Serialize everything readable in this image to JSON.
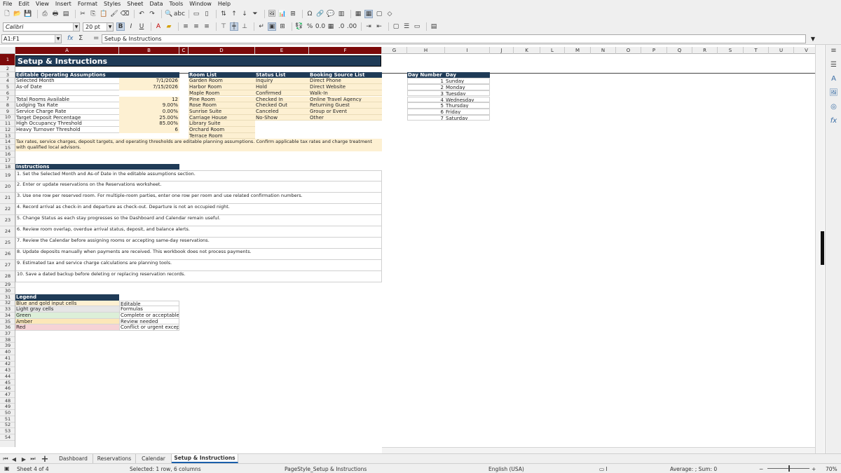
{
  "menu": [
    "File",
    "Edit",
    "View",
    "Insert",
    "Format",
    "Styles",
    "Sheet",
    "Data",
    "Tools",
    "Window",
    "Help"
  ],
  "font": {
    "name": "Calibri",
    "size": "20 pt"
  },
  "formula_bar": {
    "name_box": "A1:F1",
    "fx": "fx",
    "sum": "Σ",
    "equals": "=",
    "content": "Setup & Instructions"
  },
  "columns": [
    "A",
    "B",
    "C",
    "D",
    "E",
    "F",
    "G",
    "H",
    "I",
    "J",
    "K",
    "L",
    "M",
    "N",
    "O",
    "P",
    "Q",
    "R",
    "S",
    "T",
    "U",
    "V"
  ],
  "title": "Setup & Instructions",
  "assumptions": {
    "header": "Editable Operating Assumptions",
    "rows": [
      {
        "label": "Selected Month",
        "value": "7/1/2026"
      },
      {
        "label": "As-of Date",
        "value": "7/15/2026"
      },
      {
        "label": "",
        "value": ""
      },
      {
        "label": "Total Rooms Available",
        "value": "12"
      },
      {
        "label": "Lodging Tax Rate",
        "value": "9.00%"
      },
      {
        "label": "Service Charge Rate",
        "value": "0.00%"
      },
      {
        "label": "Target Deposit Percentage",
        "value": "25.00%"
      },
      {
        "label": "High Occupancy Threshold",
        "value": "85.00%"
      },
      {
        "label": "Heavy Turnover Threshold",
        "value": "6"
      }
    ]
  },
  "room_list": {
    "header": "Room List",
    "items": [
      "Garden Room",
      "Harbor Room",
      "Maple Room",
      "Pine Room",
      "Rose Room",
      "Sunrise Suite",
      "Carriage House",
      "Library Suite",
      "Orchard Room",
      "Terrace Room"
    ]
  },
  "status_list": {
    "header": "Status List",
    "items": [
      "Inquiry",
      "Hold",
      "Confirmed",
      "Checked In",
      "Checked Out",
      "Canceled",
      "No-Show"
    ]
  },
  "booking_list": {
    "header": "Booking Source List",
    "items": [
      "Direct Phone",
      "Direct Website",
      "Walk-In",
      "Online Travel Agency",
      "Returning Guest",
      "Group or Event",
      "Other"
    ]
  },
  "days": {
    "header_num": "Day Number",
    "header_day": "Day",
    "rows": [
      {
        "n": "1",
        "d": "Sunday"
      },
      {
        "n": "2",
        "d": "Monday"
      },
      {
        "n": "3",
        "d": "Tuesday"
      },
      {
        "n": "4",
        "d": "Wednesday"
      },
      {
        "n": "5",
        "d": "Thursday"
      },
      {
        "n": "6",
        "d": "Friday"
      },
      {
        "n": "7",
        "d": "Saturday"
      }
    ]
  },
  "note": "Tax rates, service charges, deposit targets, and operating thresholds are editable planning assumptions. Confirm applicable tax rates and charge treatment with qualified local advisors.",
  "instructions": {
    "header": "Instructions",
    "items": [
      "1. Set the Selected Month and As-of Date in the editable assumptions section.",
      "2. Enter or update reservations on the Reservations worksheet.",
      "3. Use one row per reserved room. For multiple-room parties, enter one row per room and use related confirmation numbers.",
      "4. Record arrival as check-in and departure as check-out. Departure is not an occupied night.",
      "5. Change Status as each stay progresses so the Dashboard and Calendar remain useful.",
      "6. Review room overlap, overdue arrival status, deposit, and balance alerts.",
      "7. Review the Calendar before assigning rooms or accepting same-day reservations.",
      "8. Update deposits manually when payments are received. This workbook does not process payments.",
      "9. Estimated tax and service charge calculations are planning tools.",
      "10. Save a dated backup before deleting or replacing reservation records."
    ]
  },
  "legend": {
    "header": "Legend",
    "items": [
      {
        "swatch": "Blue and gold input cells",
        "meaning": "Editable",
        "color": "#fdf0d2"
      },
      {
        "swatch": "Light gray cells",
        "meaning": "Formulas",
        "color": "#e6e6e6"
      },
      {
        "swatch": "Green",
        "meaning": "Complete or acceptable",
        "color": "#dcefd8"
      },
      {
        "swatch": "Amber",
        "meaning": "Review needed",
        "color": "#fce7b8"
      },
      {
        "swatch": "Red",
        "meaning": "Conflict or urgent exception",
        "color": "#f6d3d6"
      }
    ]
  },
  "tabs": [
    "Dashboard",
    "Reservations",
    "Calendar",
    "Setup & Instructions"
  ],
  "active_tab": "Setup & Instructions",
  "status": {
    "sheet": "Sheet 4 of 4",
    "selection": "Selected: 1 row, 6 columns",
    "page_style": "PageStyle_Setup & Instructions",
    "language": "English (USA)",
    "sum": "Average: ; Sum: 0",
    "zoom": "70%"
  },
  "colors": {
    "header_blue": "#1f3b57",
    "selected_header": "#7c0a0a",
    "input_gold": "#fdf0d2"
  }
}
